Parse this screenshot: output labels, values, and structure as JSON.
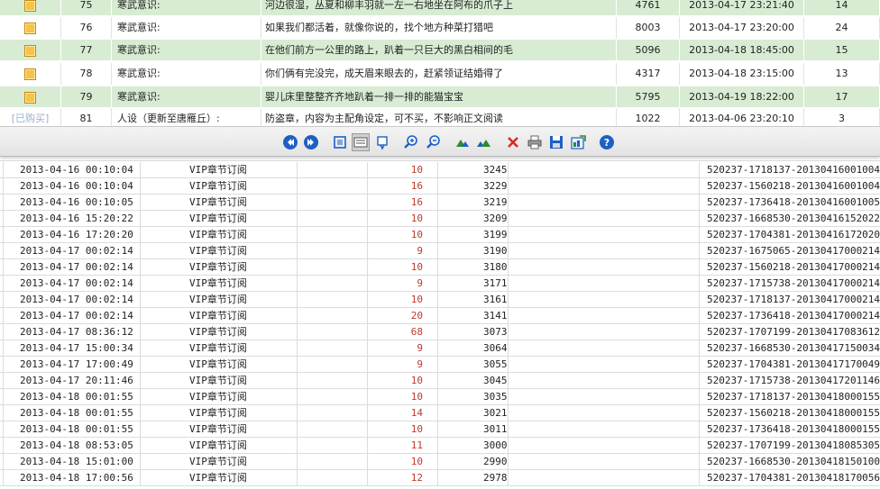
{
  "chapters": {
    "partial_label": "[已购买]",
    "rows": [
      {
        "num": "75",
        "volume": "寒武意识:",
        "title": "河边很湿，丛夏和柳丰羽就一左一右地坐在阿布的爪子上",
        "words": "4761",
        "time": "2013-04-17 23:21:40",
        "rating": "14"
      },
      {
        "num": "76",
        "volume": "寒武意识:",
        "title": "如果我们都活着，就像你说的，找个地方种菜打猎吧",
        "words": "8003",
        "time": "2013-04-17 23:20:00",
        "rating": "24"
      },
      {
        "num": "77",
        "volume": "寒武意识:",
        "title": "在他们前方一公里的路上，趴着一只巨大的黑白相间的毛",
        "words": "5096",
        "time": "2013-04-18 18:45:00",
        "rating": "15"
      },
      {
        "num": "78",
        "volume": "寒武意识:",
        "title": "你们俩有完没完，成天眉来眼去的，赶紧领证结婚得了",
        "words": "4317",
        "time": "2013-04-18 23:15:00",
        "rating": "13"
      },
      {
        "num": "79",
        "volume": "寒武意识:",
        "title": "婴儿床里整整齐齐地趴着一排一排的能猫宝宝",
        "words": "5795",
        "time": "2013-04-19 18:22:00",
        "rating": "17"
      },
      {
        "num": "81",
        "volume": "人设（更新至唐雁丘）:",
        "title": "防盗章，内容为主配角设定，可不买，不影响正文阅读",
        "words": "1022",
        "time": "2013-04-06 23:20:10",
        "rating": "3"
      }
    ]
  },
  "toolbar": {
    "icons": [
      "prev-page-icon",
      "next-page-icon",
      "fit-page-icon",
      "fit-width-icon",
      "bookmark-icon",
      "zoom-in-icon",
      "zoom-out-icon",
      "sort-ascending-icon",
      "sort-descending-icon",
      "close-icon",
      "print-icon",
      "save-icon",
      "export-icon",
      "help-icon"
    ]
  },
  "subscriptions": {
    "rows": [
      {
        "date": "2013-04-16 00:10:04",
        "type": "VIP章节订阅",
        "cost": "10",
        "words": "3245",
        "order": "520237-1718137-20130416001004"
      },
      {
        "date": "2013-04-16 00:10:04",
        "type": "VIP章节订阅",
        "cost": "16",
        "words": "3229",
        "order": "520237-1560218-20130416001004"
      },
      {
        "date": "2013-04-16 00:10:05",
        "type": "VIP章节订阅",
        "cost": "16",
        "words": "3219",
        "order": "520237-1736418-20130416001005"
      },
      {
        "date": "2013-04-16 15:20:22",
        "type": "VIP章节订阅",
        "cost": "10",
        "words": "3209",
        "order": "520237-1668530-20130416152022"
      },
      {
        "date": "2013-04-16 17:20:20",
        "type": "VIP章节订阅",
        "cost": "10",
        "words": "3199",
        "order": "520237-1704381-20130416172020"
      },
      {
        "date": "2013-04-17 00:02:14",
        "type": "VIP章节订阅",
        "cost": "9",
        "words": "3190",
        "order": "520237-1675065-20130417000214"
      },
      {
        "date": "2013-04-17 00:02:14",
        "type": "VIP章节订阅",
        "cost": "10",
        "words": "3180",
        "order": "520237-1560218-20130417000214"
      },
      {
        "date": "2013-04-17 00:02:14",
        "type": "VIP章节订阅",
        "cost": "9",
        "words": "3171",
        "order": "520237-1715738-20130417000214"
      },
      {
        "date": "2013-04-17 00:02:14",
        "type": "VIP章节订阅",
        "cost": "10",
        "words": "3161",
        "order": "520237-1718137-20130417000214"
      },
      {
        "date": "2013-04-17 00:02:14",
        "type": "VIP章节订阅",
        "cost": "20",
        "words": "3141",
        "order": "520237-1736418-20130417000214"
      },
      {
        "date": "2013-04-17 08:36:12",
        "type": "VIP章节订阅",
        "cost": "68",
        "words": "3073",
        "order": "520237-1707199-20130417083612"
      },
      {
        "date": "2013-04-17 15:00:34",
        "type": "VIP章节订阅",
        "cost": "9",
        "words": "3064",
        "order": "520237-1668530-20130417150034"
      },
      {
        "date": "2013-04-17 17:00:49",
        "type": "VIP章节订阅",
        "cost": "9",
        "words": "3055",
        "order": "520237-1704381-20130417170049"
      },
      {
        "date": "2013-04-17 20:11:46",
        "type": "VIP章节订阅",
        "cost": "10",
        "words": "3045",
        "order": "520237-1715738-20130417201146"
      },
      {
        "date": "2013-04-18 00:01:55",
        "type": "VIP章节订阅",
        "cost": "10",
        "words": "3035",
        "order": "520237-1718137-20130418000155"
      },
      {
        "date": "2013-04-18 00:01:55",
        "type": "VIP章节订阅",
        "cost": "14",
        "words": "3021",
        "order": "520237-1560218-20130418000155"
      },
      {
        "date": "2013-04-18 00:01:55",
        "type": "VIP章节订阅",
        "cost": "10",
        "words": "3011",
        "order": "520237-1736418-20130418000155"
      },
      {
        "date": "2013-04-18 08:53:05",
        "type": "VIP章节订阅",
        "cost": "11",
        "words": "3000",
        "order": "520237-1707199-20130418085305"
      },
      {
        "date": "2013-04-18 15:01:00",
        "type": "VIP章节订阅",
        "cost": "10",
        "words": "2990",
        "order": "520237-1668530-20130418150100"
      },
      {
        "date": "2013-04-18 17:00:56",
        "type": "VIP章节订阅",
        "cost": "12",
        "words": "2978",
        "order": "520237-1704381-20130418170056"
      }
    ]
  },
  "colors": {
    "row_green": "#d7ecd3",
    "cost_red": "#c0392b",
    "checkbox": "#f5c24a",
    "toolbar_blue": "#1e5fc4",
    "toolbar_green": "#2e8b2e",
    "toolbar_red": "#d62a2a"
  }
}
